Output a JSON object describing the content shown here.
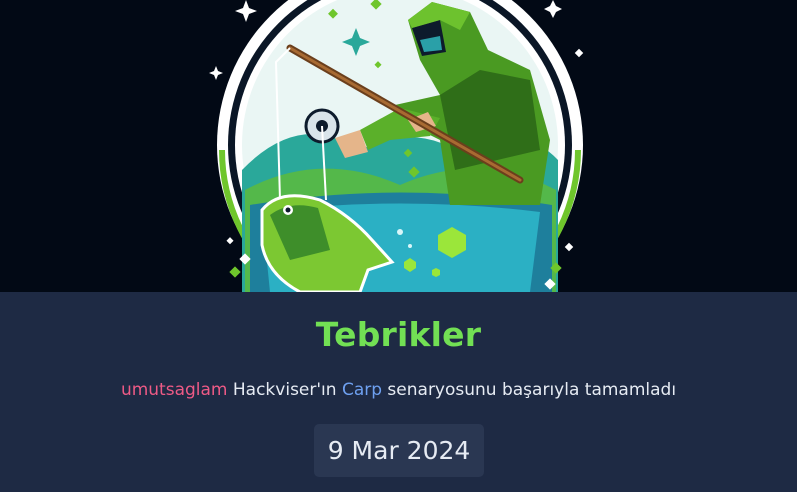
{
  "badge": {
    "alt": "Carp scenario badge"
  },
  "completion": {
    "title": "Tebrikler",
    "username": "umutsaglam",
    "text_before": " Hackviser'ın ",
    "scenario": "Carp",
    "text_after": " senaryosunu başarıyla tamamladı",
    "date": "9 Mar 2024"
  },
  "colors": {
    "title": "#72e054",
    "username": "#ee5a86",
    "scenario": "#6ea0f0",
    "panel": "#1e2a44",
    "date_box": "#2a3752"
  }
}
